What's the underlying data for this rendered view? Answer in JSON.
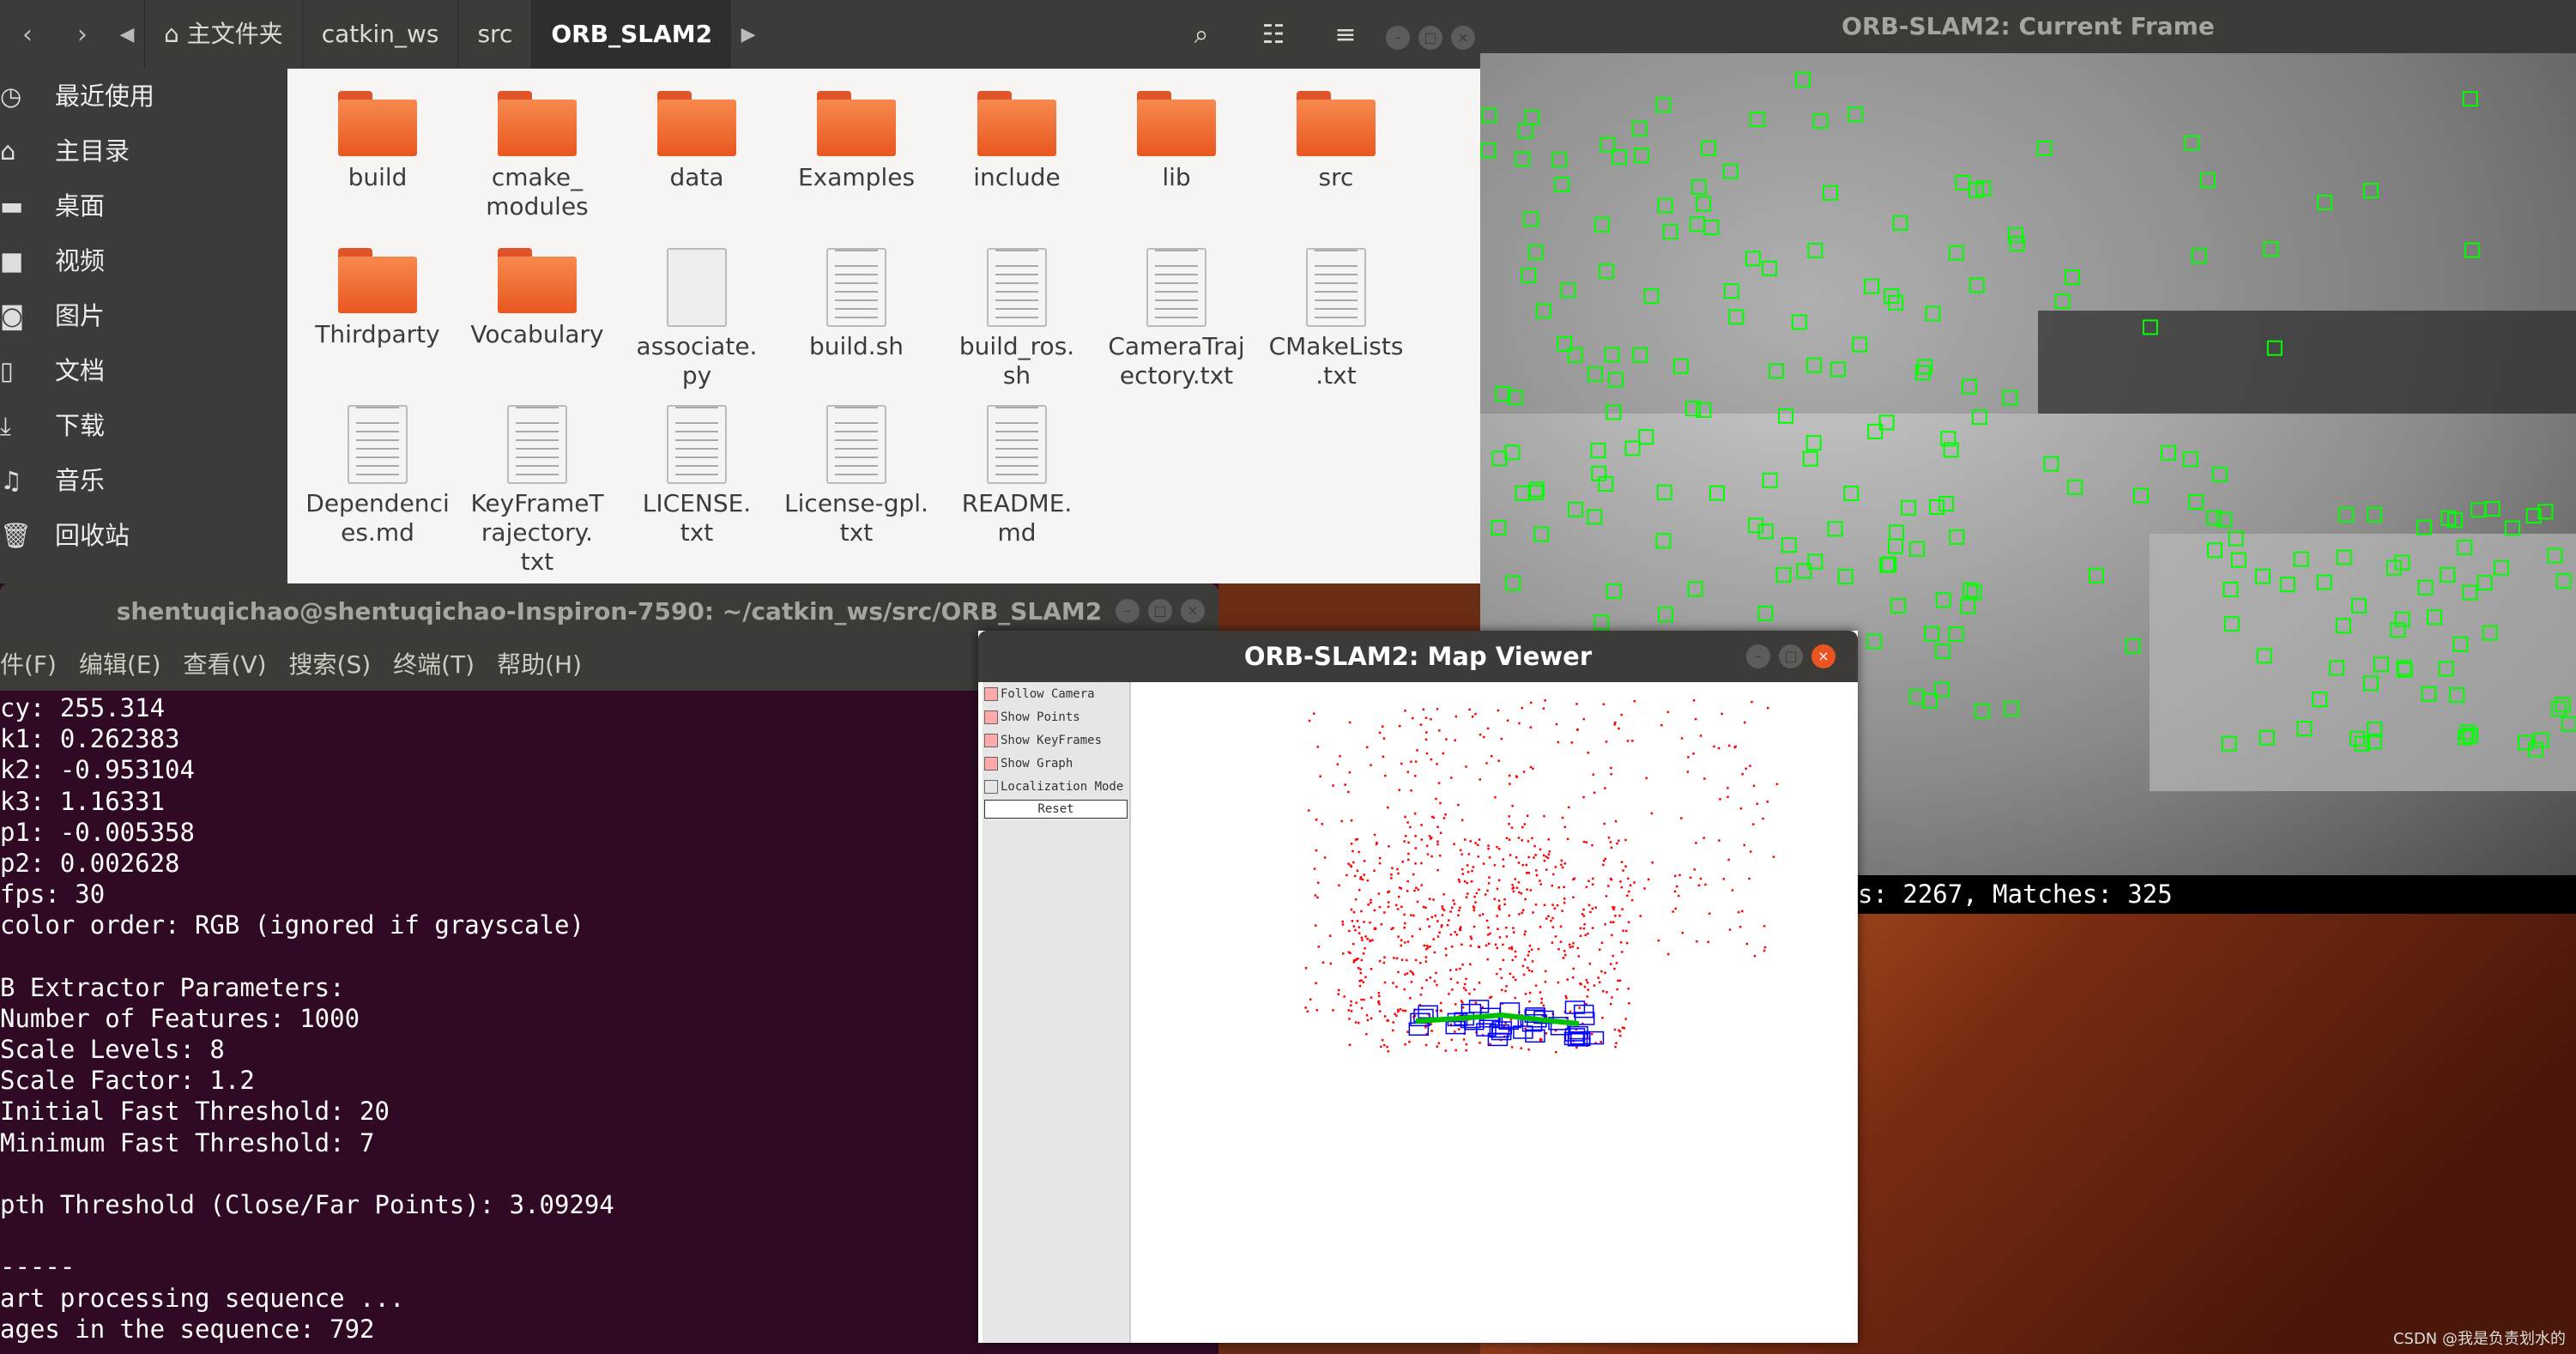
{
  "file_manager": {
    "breadcrumbs": [
      "主文件夹",
      "catkin_ws",
      "src",
      "ORB_SLAM2"
    ],
    "home_icon": "home-icon",
    "sidebar": [
      "最近使用",
      "主目录",
      "桌面",
      "视频",
      "图片",
      "文档",
      "下载",
      "音乐",
      "回收站"
    ],
    "items": [
      {
        "name": "build",
        "type": "folder"
      },
      {
        "name": "cmake_\nmodules",
        "type": "folder"
      },
      {
        "name": "data",
        "type": "folder"
      },
      {
        "name": "Examples",
        "type": "folder"
      },
      {
        "name": "include",
        "type": "folder"
      },
      {
        "name": "lib",
        "type": "folder"
      },
      {
        "name": "src",
        "type": "folder"
      },
      {
        "name": "Thirdparty",
        "type": "folder"
      },
      {
        "name": "Vocabulary",
        "type": "folder"
      },
      {
        "name": "associate.\npy",
        "type": "python"
      },
      {
        "name": "build.sh",
        "type": "script"
      },
      {
        "name": "build_ros.\nsh",
        "type": "script"
      },
      {
        "name": "CameraTraj\nectory.txt",
        "type": "text"
      },
      {
        "name": "CMakeLists\n.txt",
        "type": "text"
      },
      {
        "name": "Dependenci\nes.md",
        "type": "text"
      },
      {
        "name": "KeyFrameT\nrajectory.\ntxt",
        "type": "text"
      },
      {
        "name": "LICENSE.\ntxt",
        "type": "text"
      },
      {
        "name": "License-gpl.\ntxt",
        "type": "text"
      },
      {
        "name": "README.\nmd",
        "type": "text"
      }
    ]
  },
  "terminal": {
    "title": "shentuqichao@shentuqichao-Inspiron-7590: ~/catkin_ws/src/ORB_SLAM2",
    "menu": [
      "件(F)",
      "编辑(E)",
      "查看(V)",
      "搜索(S)",
      "终端(T)",
      "帮助(H)"
    ],
    "lines": [
      "cy: 255.314",
      "k1: 0.262383",
      "k2: -0.953104",
      "k3: 1.16331",
      "p1: -0.005358",
      "p2: 0.002628",
      "fps: 30",
      "color order: RGB (ignored if grayscale)",
      "",
      "B Extractor Parameters:",
      "Number of Features: 1000",
      "Scale Levels: 8",
      "Scale Factor: 1.2",
      "Initial Fast Threshold: 20",
      "Minimum Fast Threshold: 7",
      "",
      "pth Threshold (Close/Far Points): 3.09294",
      "",
      "-----",
      "art processing sequence ...",
      "ages in the sequence: 792"
    ]
  },
  "map_viewer": {
    "title": "ORB-SLAM2: Map Viewer",
    "options": [
      {
        "label": "Follow Camera",
        "checked": true
      },
      {
        "label": "Show Points",
        "checked": true
      },
      {
        "label": "Show KeyFrames",
        "checked": true
      },
      {
        "label": "Show Graph",
        "checked": true
      },
      {
        "label": "Localization Mode",
        "checked": false
      }
    ],
    "reset_label": "Reset",
    "colors": {
      "map_points": "#ff0000",
      "keyframes": "#0000ff",
      "graph": "#00c000"
    }
  },
  "current_frame": {
    "title": "ORB-SLAM2: Current Frame",
    "status": "s: 2267, Matches: 325",
    "feature_color": "#00ff00"
  },
  "watermark": "CSDN @我是负责划水的"
}
